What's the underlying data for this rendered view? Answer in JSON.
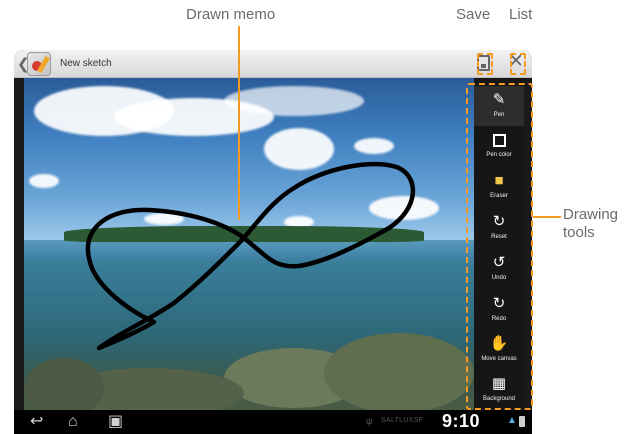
{
  "callouts": {
    "drawn_memo": "Drawn memo",
    "save": "Save",
    "list": "List",
    "drawing_tools": "Drawing tools"
  },
  "titlebar": {
    "title": "New sketch",
    "back_icon": "chevron-left-icon",
    "app_icon": "sketch-memo-app-icon",
    "save_icon": "save-disk-icon",
    "close_icon": "close-x-icon"
  },
  "toolbar": {
    "items": [
      {
        "label": "Pen",
        "icon": "pen-icon"
      },
      {
        "label": "Pen color",
        "icon": "pen-color-square-icon"
      },
      {
        "label": "Eraser",
        "icon": "eraser-icon"
      },
      {
        "label": "Reset",
        "icon": "reset-icon"
      },
      {
        "label": "Undo",
        "icon": "undo-icon"
      },
      {
        "label": "Redo",
        "icon": "redo-icon"
      },
      {
        "label": "Move canvas",
        "icon": "hand-icon"
      },
      {
        "label": "Background",
        "icon": "background-icon"
      }
    ],
    "active_index": 0
  },
  "navbar": {
    "back_icon": "back-arrow-icon",
    "home_icon": "home-icon",
    "recent_icon": "recent-apps-icon"
  },
  "status": {
    "carrier": "SALTLUXSF",
    "time": "9:10"
  },
  "colors": {
    "accent": "#f59a23",
    "toolbar_bg": "#161616",
    "callout_text": "#6b6b6b"
  }
}
